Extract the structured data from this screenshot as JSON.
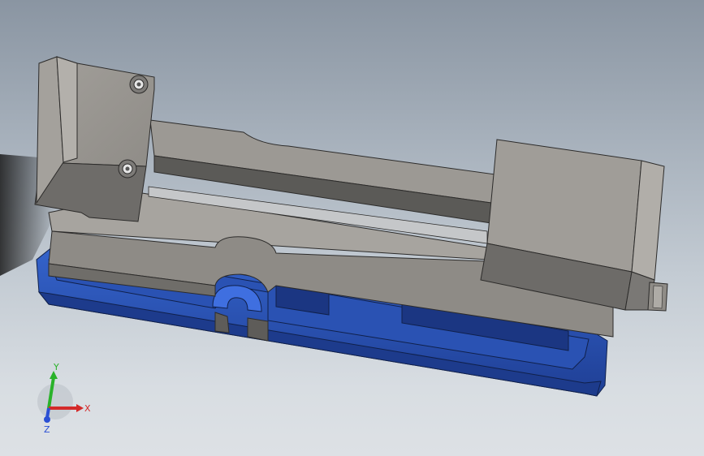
{
  "viewport": {
    "background_top": "#8a95a2",
    "background_bottom": "#dde1e5"
  },
  "model": {
    "name": "",
    "colors": {
      "steel": "#8f8c87",
      "steel_light": "#a29f9a",
      "steel_dark": "#5e5c59",
      "base_blue": "#2c55b8",
      "base_blue_dark": "#1d3b8c",
      "base_blue_light": "#3f6fe0"
    }
  },
  "triad": {
    "x_label": "X",
    "y_label": "Y",
    "z_label": "Z",
    "x_color": "#d42a2a",
    "y_color": "#2ab22a",
    "z_color": "#2a4fd4"
  }
}
